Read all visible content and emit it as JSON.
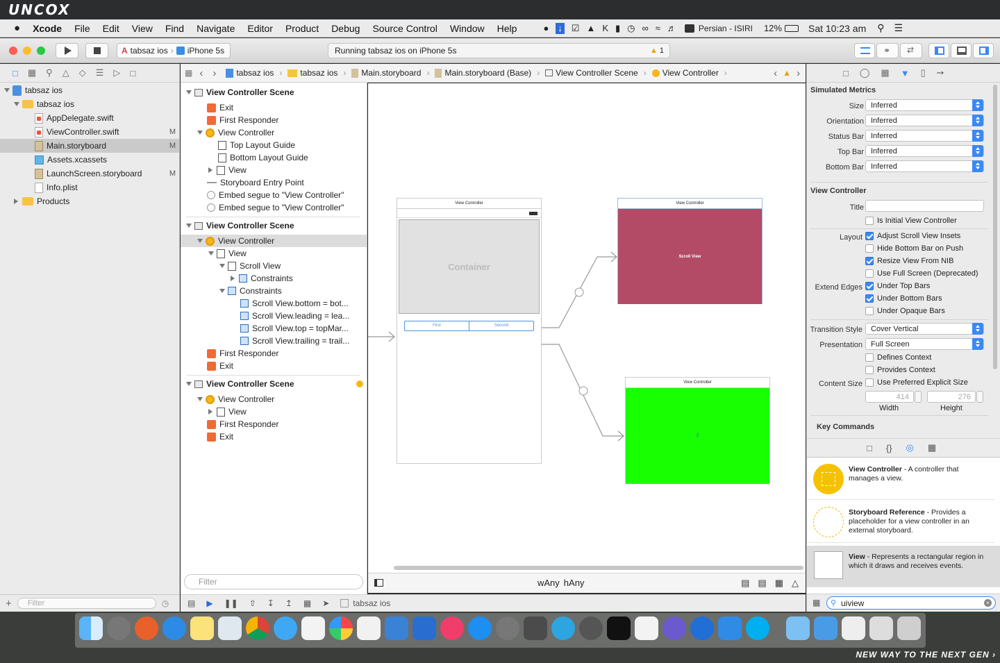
{
  "brand": "UNCOX",
  "slogan": "NEW WAY TO THE NEXT GEN ›",
  "menubar": {
    "app": "Xcode",
    "items": [
      "File",
      "Edit",
      "View",
      "Find",
      "Navigate",
      "Editor",
      "Product",
      "Debug",
      "Source Control",
      "Window",
      "Help"
    ],
    "input_source": "Persian - ISIRI",
    "battery": "12%",
    "clock": "Sat 10:23 am"
  },
  "toolbar": {
    "scheme": "tabsaz ios",
    "device": "iPhone 5s",
    "activity": "Running tabsaz ios on iPhone 5s",
    "warnings": "1"
  },
  "navigator": {
    "items": [
      {
        "label": "tabsaz ios",
        "badge": "",
        "type": "project"
      },
      {
        "label": "tabsaz ios",
        "badge": "",
        "type": "folder"
      },
      {
        "label": "AppDelegate.swift",
        "badge": "",
        "type": "swift"
      },
      {
        "label": "ViewController.swift",
        "badge": "M",
        "type": "swift"
      },
      {
        "label": "Main.storyboard",
        "badge": "M",
        "type": "storyboard"
      },
      {
        "label": "Assets.xcassets",
        "badge": "",
        "type": "xcassets"
      },
      {
        "label": "LaunchScreen.storyboard",
        "badge": "M",
        "type": "storyboard"
      },
      {
        "label": "Info.plist",
        "badge": "",
        "type": "file"
      },
      {
        "label": "Products",
        "badge": "",
        "type": "folder"
      }
    ],
    "filter_placeholder": "Filter"
  },
  "jumpbar": {
    "crumbs": [
      "tabsaz ios",
      "tabsaz ios",
      "Main.storyboard",
      "Main.storyboard (Base)",
      "View Controller Scene",
      "View Controller"
    ]
  },
  "outline": {
    "rows": [
      "View Controller Scene",
      "Exit",
      "First Responder",
      "View Controller",
      "Top Layout Guide",
      "Bottom Layout Guide",
      "View",
      "Storyboard Entry Point",
      "Embed segue to \"View Controller\"",
      "Embed segue to \"View Controller\"",
      "View Controller Scene",
      "View Controller",
      "View",
      "Scroll View",
      "Constraints",
      "Constraints",
      "Scroll View.bottom = bot...",
      "Scroll View.leading = lea...",
      "Scroll View.top = topMar...",
      "Scroll View.trailing = trail...",
      "First Responder",
      "Exit",
      "View Controller Scene",
      "View Controller",
      "View",
      "First Responder",
      "Exit"
    ],
    "filter_placeholder": "Filter"
  },
  "canvas": {
    "vc_title": "View Controller",
    "container_label": "Container",
    "seg_first": "First",
    "seg_second": "Second",
    "scroll_label": "Scroll View",
    "green_label": "2",
    "size_w": "wAny",
    "size_h": "hAny"
  },
  "inspector": {
    "simulated_title": "Simulated Metrics",
    "metrics": [
      {
        "label": "Size",
        "value": "Inferred"
      },
      {
        "label": "Orientation",
        "value": "Inferred"
      },
      {
        "label": "Status Bar",
        "value": "Inferred"
      },
      {
        "label": "Top Bar",
        "value": "Inferred"
      },
      {
        "label": "Bottom Bar",
        "value": "Inferred"
      }
    ],
    "vc_title": "View Controller",
    "title_label": "Title",
    "is_initial": "Is Initial View Controller",
    "layout_label": "Layout",
    "extend_label": "Extend Edges",
    "checks": [
      {
        "label": "Adjust Scroll View Insets",
        "on": true
      },
      {
        "label": "Hide Bottom Bar on Push",
        "on": false
      },
      {
        "label": "Resize View From NIB",
        "on": true
      },
      {
        "label": "Use Full Screen (Deprecated)",
        "on": false
      },
      {
        "label": "Under Top Bars",
        "on": true
      },
      {
        "label": "Under Bottom Bars",
        "on": true
      },
      {
        "label": "Under Opaque Bars",
        "on": false
      }
    ],
    "transition_label": "Transition Style",
    "transition_value": "Cover Vertical",
    "presentation_label": "Presentation",
    "presentation_value": "Full Screen",
    "defines_context": "Defines Context",
    "provides_context": "Provides Context",
    "content_size_label": "Content Size",
    "preferred_size": "Use Preferred Explicit Size",
    "width_val": "414",
    "height_val": "276",
    "width_label": "Width",
    "height_label": "Height",
    "key_commands": "Key Commands"
  },
  "library": {
    "items": [
      {
        "title": "View Controller",
        "desc": " - A controller that manages a view."
      },
      {
        "title": "Storyboard Reference",
        "desc": " - Provides a placeholder for a view controller in an external storyboard."
      },
      {
        "title": "View",
        "desc": " - Represents a rectangular region in which it draws and receives events."
      }
    ],
    "search_value": "uiview"
  },
  "bottom_bar": {
    "project": "tabsaz ios"
  },
  "colors": {
    "scroll_view": "#b34b67",
    "green_view": "#17ff00",
    "accent": "#3b88f5"
  }
}
